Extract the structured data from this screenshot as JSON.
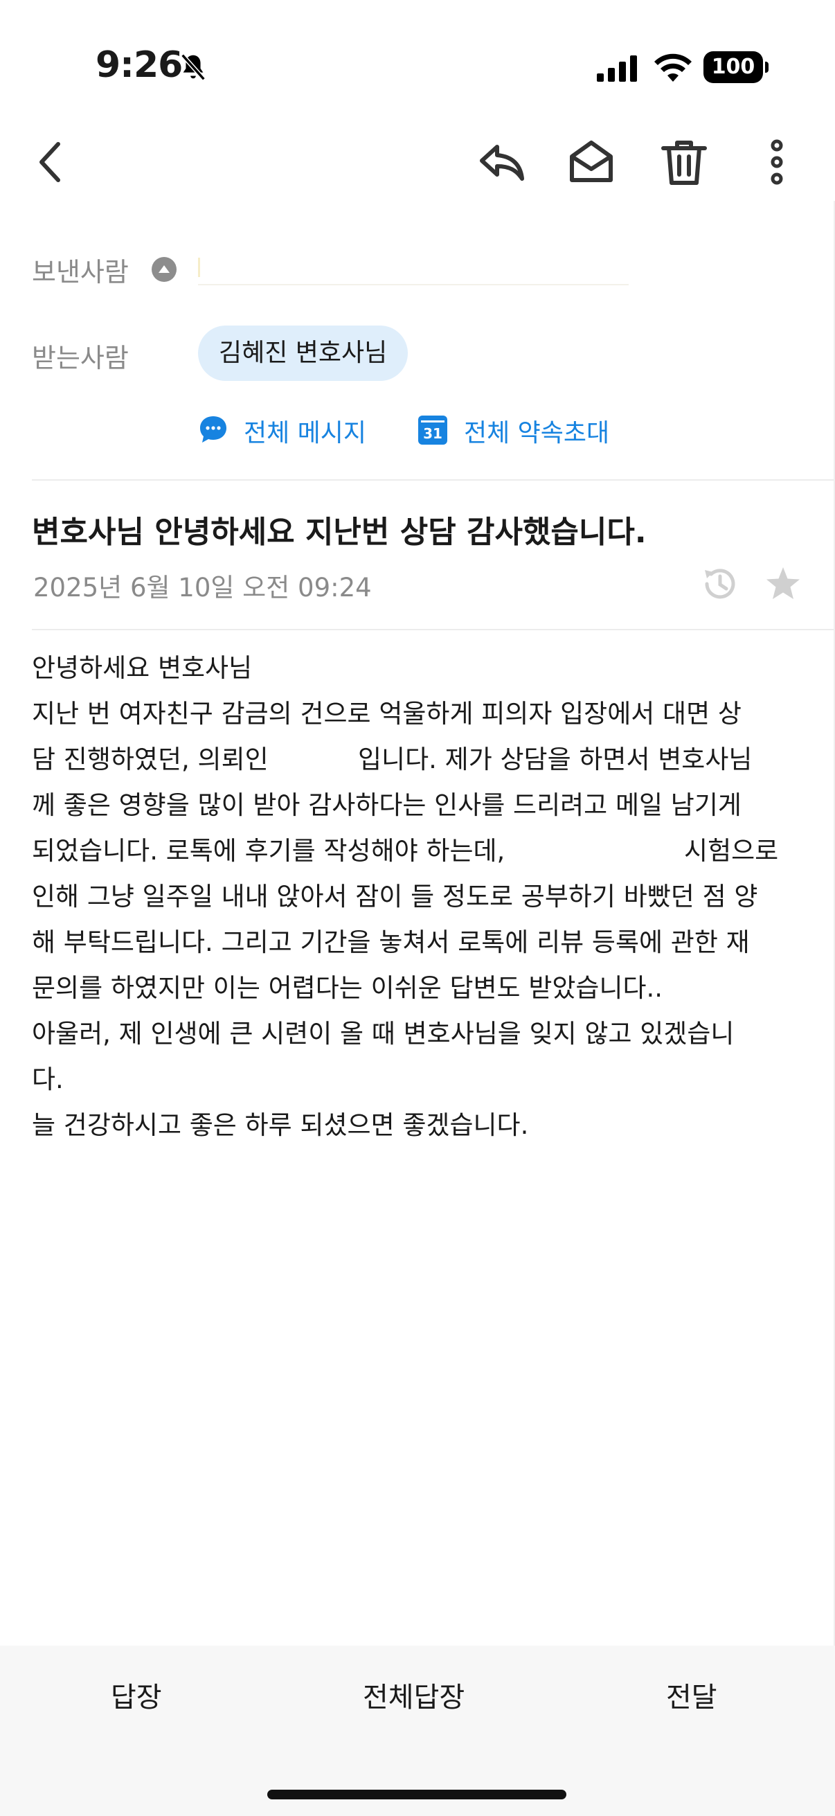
{
  "status": {
    "time": "9:26",
    "battery": "100"
  },
  "header": {
    "from_label": "보낸사람",
    "to_label": "받는사람",
    "recipient_chip": "김혜진 변호사님",
    "message_all": "전체 메시지",
    "invite_all": "전체 약속초대",
    "calendar_day": "31"
  },
  "mail": {
    "subject": "변호사님 안녕하세요 지난번 상담 감사했습니다.",
    "date": "2025년 6월 10일 오전 09:24",
    "body": "안녕하세요 변호사님\n지난 번 여자친구 감금의 건으로 억울하게 피의자 입장에서 대면 상\n담 진행하였던, 의뢰인           입니다. 제가 상담을 하면서 변호사님\n께 좋은 영향을 많이 받아 감사하다는 인사를 드리려고 메일 남기게\n되었습니다. 로톡에 후기를 작성해야 하는데,                      시험으로\n인해 그냥 일주일 내내 앉아서 잠이 들 정도로 공부하기 바빴던 점 양\n해 부탁드립니다. 그리고 기간을 놓쳐서 로톡에 리뷰 등록에 관한 재\n문의를 하였지만 이는 어렵다는 이쉬운 답변도 받았습니다..\n아울러, 제 인생에 큰 시련이 올 때 변호사님을 잊지 않고 있겠습니\n다.\n늘 건강하시고 좋은 하루 되셨으면 좋겠습니다."
  },
  "bottom": {
    "reply": "답장",
    "reply_all": "전체답장",
    "forward": "전달"
  },
  "colors": {
    "accent": "#1783e0",
    "chip_bg": "#dfeefb",
    "muted": "#8a8a8a"
  }
}
